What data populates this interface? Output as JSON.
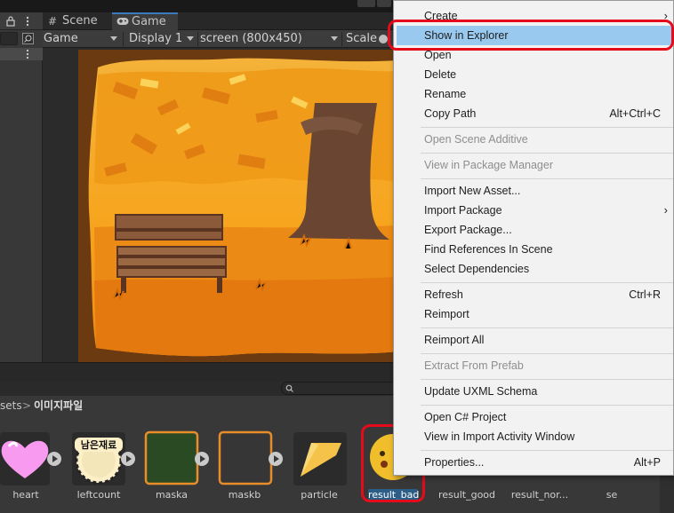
{
  "tabs": [
    {
      "label": "Scene",
      "icon": "grid-icon"
    },
    {
      "label": "Game",
      "icon": "gamepad-icon"
    }
  ],
  "game_toolbar": {
    "view_dropdown": "Game",
    "display_dropdown": "Display 1",
    "resolution_dropdown": "screen (800x450)",
    "scale_label": "Scale"
  },
  "left_panel": {
    "lock_icon": "lock-icon",
    "menu_icon": "kebab-icon"
  },
  "breadcrumb": {
    "parent": "sets",
    "separator": ">",
    "current": "이미지파일"
  },
  "assets": [
    {
      "name": "heart",
      "icon": "heart-icon"
    },
    {
      "name": "leftcount",
      "icon": "badge-icon",
      "image_text": "남은재료"
    },
    {
      "name": "maska",
      "icon": "square-green-icon"
    },
    {
      "name": "maskb",
      "icon": "square-dark-icon"
    },
    {
      "name": "particle",
      "icon": "leaf-icon"
    },
    {
      "name": "result_bad",
      "icon": "face-icon",
      "selected": true
    },
    {
      "name": "result_good",
      "icon": "face-icon"
    },
    {
      "name": "result_nor...",
      "icon": "face-icon"
    },
    {
      "name": "se",
      "icon": "image-icon"
    }
  ],
  "context_menu": {
    "items": [
      {
        "label": "Create",
        "submenu": true
      },
      {
        "label": "Show in Explorer",
        "highlighted": true
      },
      {
        "label": "Open"
      },
      {
        "label": "Delete"
      },
      {
        "label": "Rename"
      },
      {
        "label": "Copy Path",
        "shortcut": "Alt+Ctrl+C"
      },
      {
        "label": "Open Scene Additive",
        "disabled": true
      },
      {
        "label": "View in Package Manager",
        "disabled": true
      },
      {
        "label": "Import New Asset..."
      },
      {
        "label": "Import Package",
        "submenu": true
      },
      {
        "label": "Export Package..."
      },
      {
        "label": "Find References In Scene"
      },
      {
        "label": "Select Dependencies"
      },
      {
        "label": "Refresh",
        "shortcut": "Ctrl+R"
      },
      {
        "label": "Reimport"
      },
      {
        "label": "Reimport All"
      },
      {
        "label": "Extract From Prefab",
        "disabled": true
      },
      {
        "label": "Update UXML Schema"
      },
      {
        "label": "Open C# Project"
      },
      {
        "label": "View in Import Activity Window"
      },
      {
        "label": "Properties...",
        "shortcut": "Alt+P"
      }
    ],
    "submenu_glyph": "›"
  },
  "colors": {
    "highlight": "#99c9ef",
    "annotation": "#e50b1b",
    "tab_accent": "#3a79bb",
    "game_background": "#f5a623",
    "selected_label": "#2c5d87"
  }
}
